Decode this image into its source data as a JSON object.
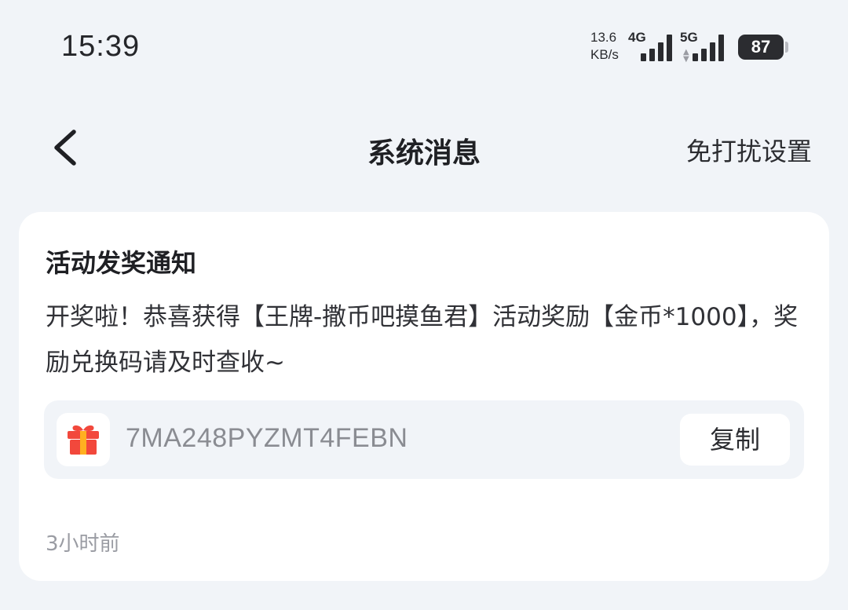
{
  "status_bar": {
    "time": "15:39",
    "net_speed_value": "13.6",
    "net_speed_unit": "KB/s",
    "sim1_network": "4G",
    "sim2_network": "5G",
    "battery": "87"
  },
  "header": {
    "back_icon": "chevron-left-icon",
    "title": "系统消息",
    "dnd_settings_label": "免打扰设置"
  },
  "message": {
    "title": "活动发奖通知",
    "body": "开奖啦！恭喜获得【王牌-撒币吧摸鱼君】活动奖励【金币*1000】，奖励兑换码请及时查收~",
    "gift_icon": "gift-icon",
    "redeem_code": "7MA248PYZMT4FEBN",
    "copy_label": "复制",
    "time_ago": "3小时前"
  },
  "colors": {
    "page_background": "#f1f4f8",
    "card_background": "#ffffff",
    "code_box_background": "#f1f4f8",
    "gift_red": "#f2483c",
    "gift_ribbon": "#ffb020",
    "muted_text": "#9a9ca3"
  }
}
